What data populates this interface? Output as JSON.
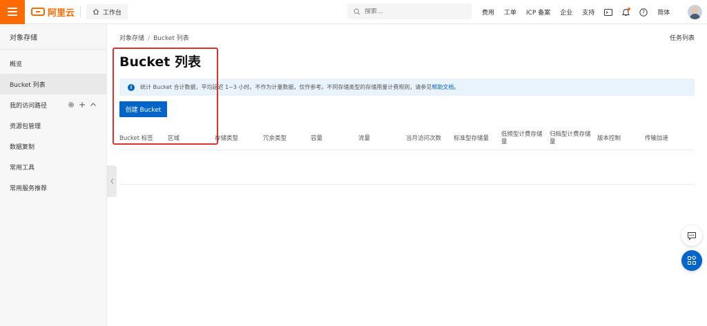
{
  "topbar": {
    "logo_text": "阿里云",
    "workbench_label": "工作台",
    "search_placeholder": "搜索...",
    "links": [
      "费用",
      "工单",
      "ICP 备案",
      "企业",
      "支持"
    ],
    "lang_label": "简体"
  },
  "sidebar": {
    "title": "对象存储",
    "items": [
      {
        "label": "概览"
      },
      {
        "label": "Bucket 列表"
      },
      {
        "label": "我的访问路径"
      },
      {
        "label": "资源包管理"
      },
      {
        "label": "数据复制"
      },
      {
        "label": "常用工具"
      },
      {
        "label": "常用服务推荐"
      }
    ]
  },
  "main": {
    "breadcrumb": [
      "对象存储",
      "Bucket 列表"
    ],
    "breadcrumb_sep": "/",
    "task_list_label": "任务列表",
    "title": "Bucket 列表",
    "info_text": "统计 Bucket 合计数据，平均延迟 1~3 小时。不作为计量数据，仅作参考。不同存储类型的存储用量计费规则，请参见",
    "info_link": "帮助文档",
    "info_end": "。",
    "create_button_label": "创建 Bucket",
    "table_headers": [
      "Bucket 标签",
      "区域",
      "存储类型",
      "冗余类型",
      "容量",
      "流量",
      "当月访问次数",
      "标准型存储量",
      "低频型计费存储量",
      "归档型计费存储量",
      "版本控制",
      "传输加速"
    ]
  },
  "colors": {
    "brand_orange": "#ff6a00",
    "primary_blue": "#0064c8",
    "highlight_red": "#e0302e",
    "info_bg": "#e8f3fc"
  }
}
